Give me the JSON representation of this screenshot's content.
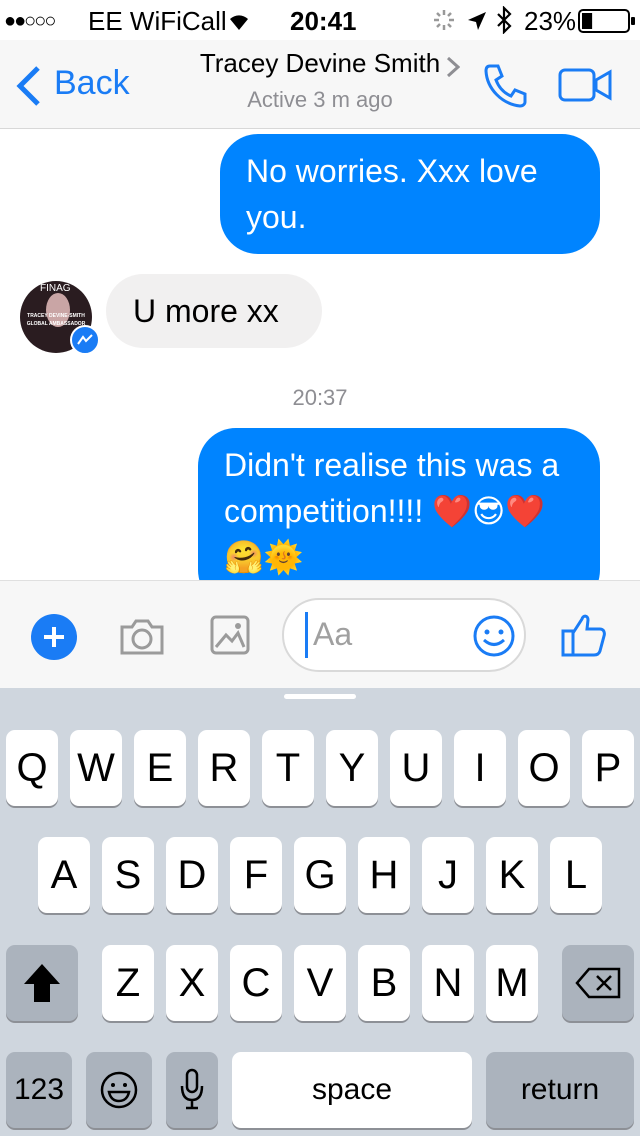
{
  "status_bar": {
    "signal": "●●○○○",
    "carrier": "EE WiFiCall",
    "time": "20:41",
    "battery_percent": "23%",
    "battery_level": 0.23
  },
  "header": {
    "back_label": "Back",
    "contact_name": "Tracey Devine Smith",
    "status": "Active 3 m ago"
  },
  "messages": [
    {
      "from": "me",
      "text": "No worries. Xxx love you."
    },
    {
      "from": "them",
      "text": "U more xx"
    },
    {
      "timestamp": "20:37"
    },
    {
      "from": "me",
      "text": "Didn't realise this was a competition!!!! ❤️😎❤️🤗🌞"
    }
  ],
  "avatar": {
    "text_top": "FINAG",
    "text_mid": "TRACEY DEVINE-SMITH",
    "text_sub": "GLOBAL AMBASSADOR"
  },
  "composer": {
    "placeholder": "Aa"
  },
  "keyboard": {
    "row1": [
      "Q",
      "W",
      "E",
      "R",
      "T",
      "Y",
      "U",
      "I",
      "O",
      "P"
    ],
    "row2": [
      "A",
      "S",
      "D",
      "F",
      "G",
      "H",
      "J",
      "K",
      "L"
    ],
    "row3": [
      "Z",
      "X",
      "C",
      "V",
      "B",
      "N",
      "M"
    ],
    "numbers_label": "123",
    "space_label": "space",
    "return_label": "return"
  }
}
